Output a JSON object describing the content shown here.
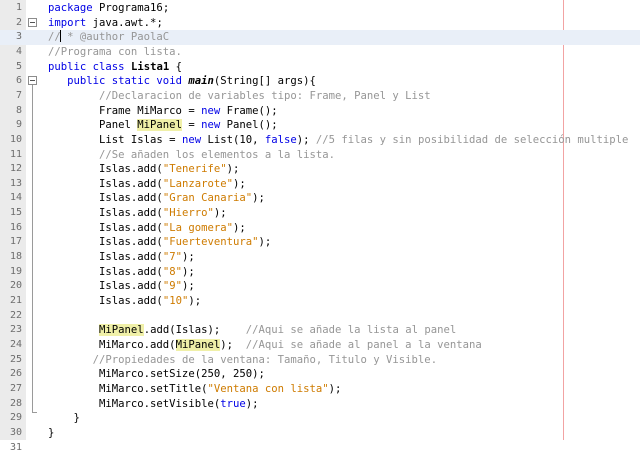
{
  "editor": {
    "lines": [
      {
        "n": "1",
        "tokens": [
          {
            "t": "kw",
            "v": "package"
          },
          {
            "t": "",
            "v": " Programa16;"
          }
        ]
      },
      {
        "n": "2",
        "tokens": [
          {
            "t": "kw",
            "v": "import"
          },
          {
            "t": "",
            "v": " java.awt.*;"
          }
        ]
      },
      {
        "n": "3",
        "tokens": [
          {
            "t": "com",
            "v": "// * @author PaolaC"
          }
        ]
      },
      {
        "n": "4",
        "tokens": [
          {
            "t": "com",
            "v": "//Programa con lista."
          }
        ]
      },
      {
        "n": "5",
        "tokens": [
          {
            "t": "kw",
            "v": "public class"
          },
          {
            "t": "",
            "v": " "
          },
          {
            "t": "b",
            "v": "Lista1"
          },
          {
            "t": "",
            "v": " {"
          }
        ]
      },
      {
        "n": "6",
        "tokens": [
          {
            "t": "",
            "v": "   "
          },
          {
            "t": "kw",
            "v": "public static void"
          },
          {
            "t": "",
            "v": " "
          },
          {
            "t": "bi",
            "v": "main"
          },
          {
            "t": "",
            "v": "(String[] args){"
          }
        ]
      },
      {
        "n": "7",
        "tokens": [
          {
            "t": "",
            "v": "        "
          },
          {
            "t": "com",
            "v": "//Declaracion de variables tipo: Frame, Panel y List"
          }
        ]
      },
      {
        "n": "8",
        "tokens": [
          {
            "t": "",
            "v": "        Frame MiMarco = "
          },
          {
            "t": "kw",
            "v": "new"
          },
          {
            "t": "",
            "v": " Frame();"
          }
        ]
      },
      {
        "n": "9",
        "tokens": [
          {
            "t": "",
            "v": "        Panel "
          },
          {
            "t": "hl",
            "v": "MiPanel"
          },
          {
            "t": "",
            "v": " = "
          },
          {
            "t": "kw",
            "v": "new"
          },
          {
            "t": "",
            "v": " Panel();"
          }
        ]
      },
      {
        "n": "10",
        "tokens": [
          {
            "t": "",
            "v": "        List Islas = "
          },
          {
            "t": "kw",
            "v": "new"
          },
          {
            "t": "",
            "v": " List(10, "
          },
          {
            "t": "kw",
            "v": "false"
          },
          {
            "t": "",
            "v": "); "
          },
          {
            "t": "com",
            "v": "//5 filas y sin posibilidad de selección multiple"
          }
        ]
      },
      {
        "n": "11",
        "tokens": [
          {
            "t": "",
            "v": "        "
          },
          {
            "t": "com",
            "v": "//Se añaden los elementos a la lista."
          }
        ]
      },
      {
        "n": "12",
        "tokens": [
          {
            "t": "",
            "v": "        Islas.add("
          },
          {
            "t": "str",
            "v": "\"Tenerife\""
          },
          {
            "t": "",
            "v": ");"
          }
        ]
      },
      {
        "n": "13",
        "tokens": [
          {
            "t": "",
            "v": "        Islas.add("
          },
          {
            "t": "str",
            "v": "\"Lanzarote\""
          },
          {
            "t": "",
            "v": ");"
          }
        ]
      },
      {
        "n": "14",
        "tokens": [
          {
            "t": "",
            "v": "        Islas.add("
          },
          {
            "t": "str",
            "v": "\"Gran Canaria\""
          },
          {
            "t": "",
            "v": ");"
          }
        ]
      },
      {
        "n": "15",
        "tokens": [
          {
            "t": "",
            "v": "        Islas.add("
          },
          {
            "t": "str",
            "v": "\"Hierro\""
          },
          {
            "t": "",
            "v": ");"
          }
        ]
      },
      {
        "n": "16",
        "tokens": [
          {
            "t": "",
            "v": "        Islas.add("
          },
          {
            "t": "str",
            "v": "\"La gomera\""
          },
          {
            "t": "",
            "v": ");"
          }
        ]
      },
      {
        "n": "17",
        "tokens": [
          {
            "t": "",
            "v": "        Islas.add("
          },
          {
            "t": "str",
            "v": "\"Fuerteventura\""
          },
          {
            "t": "",
            "v": ");"
          }
        ]
      },
      {
        "n": "18",
        "tokens": [
          {
            "t": "",
            "v": "        Islas.add("
          },
          {
            "t": "str",
            "v": "\"7\""
          },
          {
            "t": "",
            "v": ");"
          }
        ]
      },
      {
        "n": "19",
        "tokens": [
          {
            "t": "",
            "v": "        Islas.add("
          },
          {
            "t": "str",
            "v": "\"8\""
          },
          {
            "t": "",
            "v": ");"
          }
        ]
      },
      {
        "n": "20",
        "tokens": [
          {
            "t": "",
            "v": "        Islas.add("
          },
          {
            "t": "str",
            "v": "\"9\""
          },
          {
            "t": "",
            "v": ");"
          }
        ]
      },
      {
        "n": "21",
        "tokens": [
          {
            "t": "",
            "v": "        Islas.add("
          },
          {
            "t": "str",
            "v": "\"10\""
          },
          {
            "t": "",
            "v": ");"
          }
        ]
      },
      {
        "n": "22",
        "tokens": []
      },
      {
        "n": "23",
        "tokens": [
          {
            "t": "",
            "v": "        "
          },
          {
            "t": "hl",
            "v": "MiPanel"
          },
          {
            "t": "",
            "v": ".add(Islas);    "
          },
          {
            "t": "com",
            "v": "//Aqui se añade la lista al panel"
          }
        ]
      },
      {
        "n": "24",
        "tokens": [
          {
            "t": "",
            "v": "        MiMarco.add("
          },
          {
            "t": "hl",
            "v": "MiPanel"
          },
          {
            "t": "",
            "v": ");  "
          },
          {
            "t": "com",
            "v": "//Aqui se añade al panel a la ventana"
          }
        ]
      },
      {
        "n": "25",
        "tokens": [
          {
            "t": "",
            "v": "       "
          },
          {
            "t": "com",
            "v": "//Propiedades de la ventana: Tamaño, Titulo y Visible."
          }
        ]
      },
      {
        "n": "26",
        "tokens": [
          {
            "t": "",
            "v": "        MiMarco.setSize(250, 250);"
          }
        ]
      },
      {
        "n": "27",
        "tokens": [
          {
            "t": "",
            "v": "        MiMarco.setTitle("
          },
          {
            "t": "str",
            "v": "\"Ventana con lista\""
          },
          {
            "t": "",
            "v": ");"
          }
        ]
      },
      {
        "n": "28",
        "tokens": [
          {
            "t": "",
            "v": "        MiMarco.setVisible("
          },
          {
            "t": "kw",
            "v": "true"
          },
          {
            "t": "",
            "v": ");"
          }
        ]
      },
      {
        "n": "29",
        "tokens": [
          {
            "t": "",
            "v": "    }"
          }
        ]
      },
      {
        "n": "30",
        "tokens": [
          {
            "t": "",
            "v": "}"
          }
        ]
      },
      {
        "n": "31",
        "tokens": []
      }
    ],
    "current_line": "3"
  },
  "colors": {
    "keyword": "#0000e6",
    "string": "#ce7b00",
    "comment": "#969696",
    "highlight": "#f0f0a8",
    "margin_line": "#f2a3a3"
  }
}
